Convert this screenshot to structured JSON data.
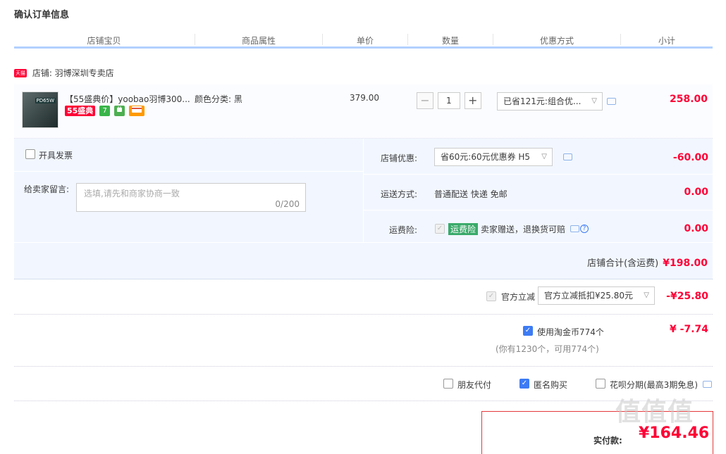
{
  "page": {
    "title": "确认订单信息"
  },
  "columns": [
    "店铺宝贝",
    "商品属性",
    "单价",
    "数量",
    "优惠方式",
    "小计"
  ],
  "shop": {
    "badge": "天猫",
    "name": "店铺: 羽博深圳专卖店"
  },
  "item": {
    "thumb_tag": "PD65W",
    "title": "【55盛典价】yoobao羽博300...",
    "badges": {
      "promo": "55盛典",
      "seven": "7"
    },
    "attr": "颜色分类: 黑",
    "unit_price": "379.00",
    "qty": "1",
    "qty_minus": "−",
    "qty_plus": "+",
    "discount_select": "已省121元:组合优...",
    "subtotal": "258.00"
  },
  "invoice": {
    "label": "开具发票"
  },
  "message": {
    "label": "给卖家留言:",
    "placeholder": "选填,请先和商家协商一致",
    "counter": "0/200"
  },
  "shop_discount": {
    "label": "店铺优惠:",
    "select": "省60元:60元优惠券 H5",
    "amount": "-60.00"
  },
  "shipping": {
    "label": "运送方式:",
    "value": "普通配送 快递 免邮",
    "amount": "0.00"
  },
  "insurance": {
    "label": "运费险:",
    "badge": "运费险",
    "text": "卖家赠送，退换货可赔",
    "amount": "0.00"
  },
  "shop_total": {
    "label": "店铺合计(含运费)",
    "amount": "¥198.00"
  },
  "official": {
    "label": "官方立减",
    "select": "官方立减抵扣¥25.80元",
    "amount": "-¥25.80"
  },
  "coins": {
    "label": "使用淘金币774个",
    "sub": "(你有1230个，可用774个)",
    "amount": "¥ -7.74"
  },
  "options": {
    "friend_pay": "朋友代付",
    "anonymous": "匿名购买",
    "huabei": "花呗分期(最高3期免息)"
  },
  "payment": {
    "label": "实付款:",
    "amount": "¥164.46"
  },
  "watermark": "值值值",
  "colors": {
    "accent": "#ff0036",
    "blue": "#3d7bf4",
    "header_line": "#b2d1ff",
    "panel_bg": "#f2f7ff"
  }
}
